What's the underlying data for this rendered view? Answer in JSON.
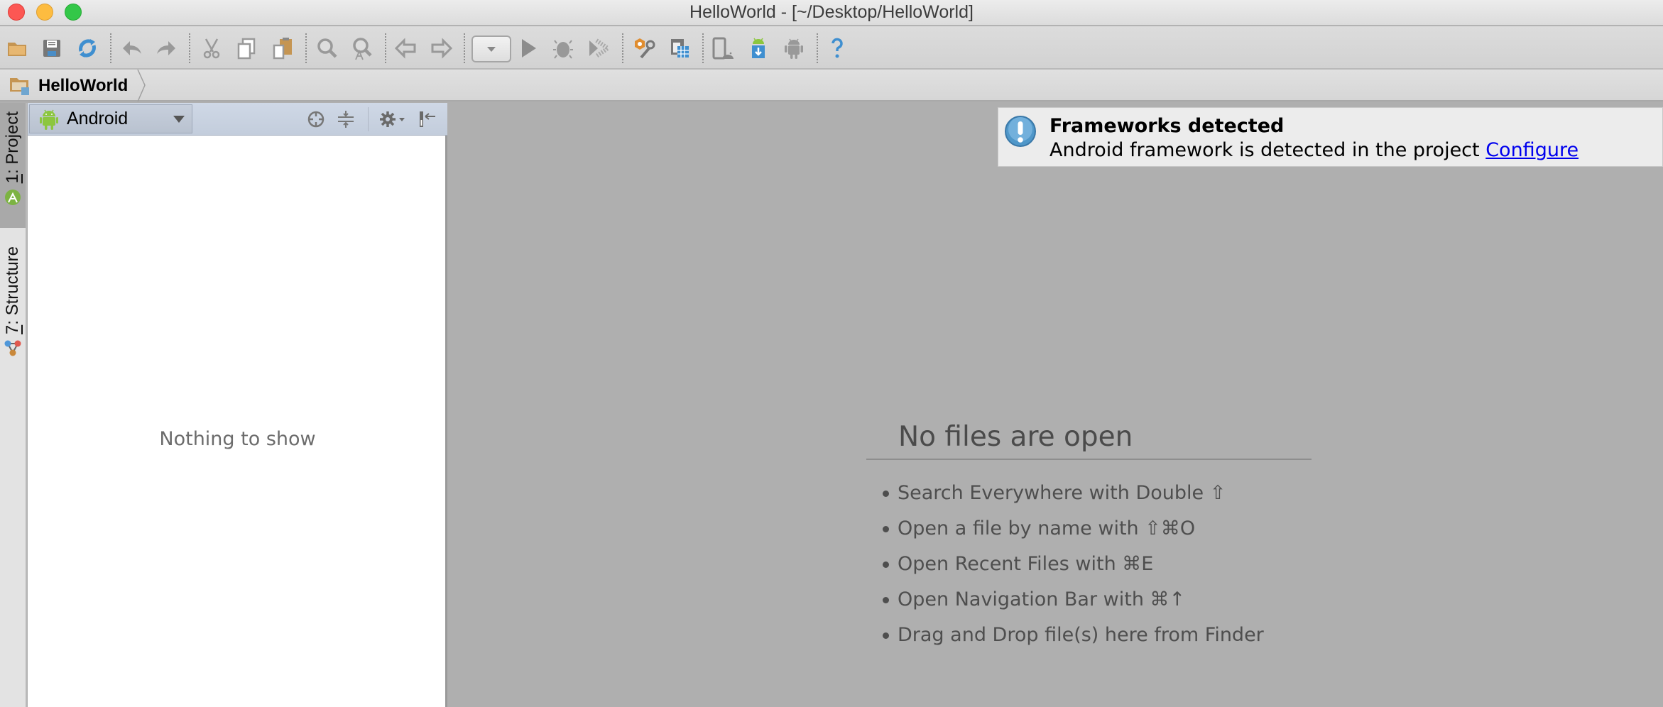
{
  "window": {
    "title": "HelloWorld - [~/Desktop/HelloWorld]"
  },
  "toolbar": {
    "items": [
      {
        "name": "open-icon",
        "label": "Open"
      },
      {
        "name": "save-icon",
        "label": "Save All"
      },
      {
        "name": "sync-icon",
        "label": "Synchronize"
      },
      {
        "name": "undo-icon",
        "label": "Undo"
      },
      {
        "name": "redo-icon",
        "label": "Redo"
      },
      {
        "name": "cut-icon",
        "label": "Cut"
      },
      {
        "name": "copy-icon",
        "label": "Copy"
      },
      {
        "name": "paste-icon",
        "label": "Paste"
      },
      {
        "name": "find-icon",
        "label": "Find"
      },
      {
        "name": "replace-icon",
        "label": "Replace"
      },
      {
        "name": "back-icon",
        "label": "Back"
      },
      {
        "name": "forward-icon",
        "label": "Forward"
      },
      {
        "name": "run-config-dropdown",
        "label": "Run Configuration"
      },
      {
        "name": "run-icon",
        "label": "Run"
      },
      {
        "name": "debug-icon",
        "label": "Debug"
      },
      {
        "name": "coverage-icon",
        "label": "Run with Coverage"
      },
      {
        "name": "project-structure-icon",
        "label": "Project Structure"
      },
      {
        "name": "sync-gradle-icon",
        "label": "Sync Project with Gradle Files"
      },
      {
        "name": "avd-manager-icon",
        "label": "AVD Manager"
      },
      {
        "name": "sdk-manager-icon",
        "label": "SDK Manager"
      },
      {
        "name": "android-monitor-icon",
        "label": "Android Device Monitor"
      },
      {
        "name": "help-icon",
        "label": "Help"
      }
    ]
  },
  "breadcrumb": {
    "items": [
      {
        "label": "HelloWorld"
      }
    ]
  },
  "stripe": {
    "tabs": [
      {
        "number": "1",
        "label": ": Project",
        "active": true
      },
      {
        "number": "7",
        "label": ": Structure",
        "active": false
      }
    ]
  },
  "project_panel": {
    "view_mode": "Android",
    "empty_text": "Nothing to show"
  },
  "notification": {
    "title": "Frameworks detected",
    "body": "Android framework is detected in the project ",
    "link": "Configure"
  },
  "editor": {
    "empty_heading": "No files are open",
    "hints": [
      "Search Everywhere with Double ⇧",
      "Open a file by name with ⇧⌘O",
      "Open Recent Files with ⌘E",
      "Open Navigation Bar with ⌘↑",
      "Drag and Drop file(s) here from Finder"
    ]
  },
  "colors": {
    "editor_background": "#afafaf",
    "panel_header": "#c7d0de",
    "link": "#0000ee",
    "android_green": "#8cc63f",
    "info_blue": "#4f97c9"
  }
}
